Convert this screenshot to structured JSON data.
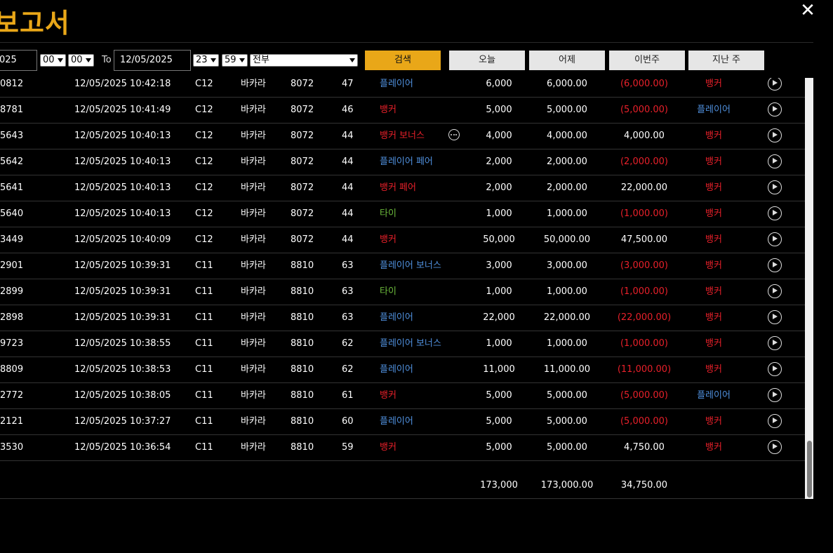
{
  "title": "보고서",
  "colors": {
    "accent": "#e9a718",
    "red": "#e8202a",
    "blue": "#4f8fdc",
    "green": "#6dbb3c"
  },
  "filters": {
    "from_date": "025",
    "from_hour": "00",
    "from_minute": "00",
    "to_label": "To",
    "to_date": "12/05/2025",
    "to_hour": "23",
    "to_minute": "59",
    "category": "전부"
  },
  "buttons": {
    "search": "검색",
    "today": "오늘",
    "yesterday": "어제",
    "this_week": "이번주",
    "last_week": "지난 주"
  },
  "rows": [
    {
      "id": "0812",
      "datetime": "12/05/2025 10:42:18",
      "table": "C12",
      "game": "바카라",
      "shoe": "8072",
      "round": "47",
      "bet": "플레이어",
      "bet_color": "blue",
      "amount": "6,000",
      "valid": "6,000.00",
      "pnl": "(6,000.00)",
      "pnl_color": "red",
      "result": "뱅커",
      "result_color": "red",
      "more": false
    },
    {
      "id": "8781",
      "datetime": "12/05/2025 10:41:49",
      "table": "C12",
      "game": "바카라",
      "shoe": "8072",
      "round": "46",
      "bet": "뱅커",
      "bet_color": "red",
      "amount": "5,000",
      "valid": "5,000.00",
      "pnl": "(5,000.00)",
      "pnl_color": "red",
      "result": "플레이어",
      "result_color": "blue",
      "more": false
    },
    {
      "id": "5643",
      "datetime": "12/05/2025 10:40:13",
      "table": "C12",
      "game": "바카라",
      "shoe": "8072",
      "round": "44",
      "bet": "뱅커 보너스",
      "bet_color": "red",
      "amount": "4,000",
      "valid": "4,000.00",
      "pnl": "4,000.00",
      "pnl_color": "white",
      "result": "뱅커",
      "result_color": "red",
      "more": true
    },
    {
      "id": "5642",
      "datetime": "12/05/2025 10:40:13",
      "table": "C12",
      "game": "바카라",
      "shoe": "8072",
      "round": "44",
      "bet": "플레이어 페어",
      "bet_color": "blue",
      "amount": "2,000",
      "valid": "2,000.00",
      "pnl": "(2,000.00)",
      "pnl_color": "red",
      "result": "뱅커",
      "result_color": "red",
      "more": false
    },
    {
      "id": "5641",
      "datetime": "12/05/2025 10:40:13",
      "table": "C12",
      "game": "바카라",
      "shoe": "8072",
      "round": "44",
      "bet": "뱅커 페어",
      "bet_color": "red",
      "amount": "2,000",
      "valid": "2,000.00",
      "pnl": "22,000.00",
      "pnl_color": "white",
      "result": "뱅커",
      "result_color": "red",
      "more": false
    },
    {
      "id": "5640",
      "datetime": "12/05/2025 10:40:13",
      "table": "C12",
      "game": "바카라",
      "shoe": "8072",
      "round": "44",
      "bet": "타이",
      "bet_color": "green",
      "amount": "1,000",
      "valid": "1,000.00",
      "pnl": "(1,000.00)",
      "pnl_color": "red",
      "result": "뱅커",
      "result_color": "red",
      "more": false
    },
    {
      "id": "3449",
      "datetime": "12/05/2025 10:40:09",
      "table": "C12",
      "game": "바카라",
      "shoe": "8072",
      "round": "44",
      "bet": "뱅커",
      "bet_color": "red",
      "amount": "50,000",
      "valid": "50,000.00",
      "pnl": "47,500.00",
      "pnl_color": "white",
      "result": "뱅커",
      "result_color": "red",
      "more": false
    },
    {
      "id": "2901",
      "datetime": "12/05/2025 10:39:31",
      "table": "C11",
      "game": "바카라",
      "shoe": "8810",
      "round": "63",
      "bet": "플레이어 보너스",
      "bet_color": "blue",
      "amount": "3,000",
      "valid": "3,000.00",
      "pnl": "(3,000.00)",
      "pnl_color": "red",
      "result": "뱅커",
      "result_color": "red",
      "more": false
    },
    {
      "id": "2899",
      "datetime": "12/05/2025 10:39:31",
      "table": "C11",
      "game": "바카라",
      "shoe": "8810",
      "round": "63",
      "bet": "타이",
      "bet_color": "green",
      "amount": "1,000",
      "valid": "1,000.00",
      "pnl": "(1,000.00)",
      "pnl_color": "red",
      "result": "뱅커",
      "result_color": "red",
      "more": false
    },
    {
      "id": "2898",
      "datetime": "12/05/2025 10:39:31",
      "table": "C11",
      "game": "바카라",
      "shoe": "8810",
      "round": "63",
      "bet": "플레이어",
      "bet_color": "blue",
      "amount": "22,000",
      "valid": "22,000.00",
      "pnl": "(22,000.00)",
      "pnl_color": "red",
      "result": "뱅커",
      "result_color": "red",
      "more": false
    },
    {
      "id": "9723",
      "datetime": "12/05/2025 10:38:55",
      "table": "C11",
      "game": "바카라",
      "shoe": "8810",
      "round": "62",
      "bet": "플레이어 보너스",
      "bet_color": "blue",
      "amount": "1,000",
      "valid": "1,000.00",
      "pnl": "(1,000.00)",
      "pnl_color": "red",
      "result": "뱅커",
      "result_color": "red",
      "more": false
    },
    {
      "id": "8809",
      "datetime": "12/05/2025 10:38:53",
      "table": "C11",
      "game": "바카라",
      "shoe": "8810",
      "round": "62",
      "bet": "플레이어",
      "bet_color": "blue",
      "amount": "11,000",
      "valid": "11,000.00",
      "pnl": "(11,000.00)",
      "pnl_color": "red",
      "result": "뱅커",
      "result_color": "red",
      "more": false
    },
    {
      "id": "2772",
      "datetime": "12/05/2025 10:38:05",
      "table": "C11",
      "game": "바카라",
      "shoe": "8810",
      "round": "61",
      "bet": "뱅커",
      "bet_color": "red",
      "amount": "5,000",
      "valid": "5,000.00",
      "pnl": "(5,000.00)",
      "pnl_color": "red",
      "result": "플레이어",
      "result_color": "blue",
      "more": false
    },
    {
      "id": "2121",
      "datetime": "12/05/2025 10:37:27",
      "table": "C11",
      "game": "바카라",
      "shoe": "8810",
      "round": "60",
      "bet": "플레이어",
      "bet_color": "blue",
      "amount": "5,000",
      "valid": "5,000.00",
      "pnl": "(5,000.00)",
      "pnl_color": "red",
      "result": "뱅커",
      "result_color": "red",
      "more": false
    },
    {
      "id": "3530",
      "datetime": "12/05/2025 10:36:54",
      "table": "C11",
      "game": "바카라",
      "shoe": "8810",
      "round": "59",
      "bet": "뱅커",
      "bet_color": "red",
      "amount": "5,000",
      "valid": "5,000.00",
      "pnl": "4,750.00",
      "pnl_color": "white",
      "result": "뱅커",
      "result_color": "red",
      "more": false
    }
  ],
  "totals": {
    "amount": "173,000",
    "valid": "173,000.00",
    "pnl": "34,750.00"
  }
}
